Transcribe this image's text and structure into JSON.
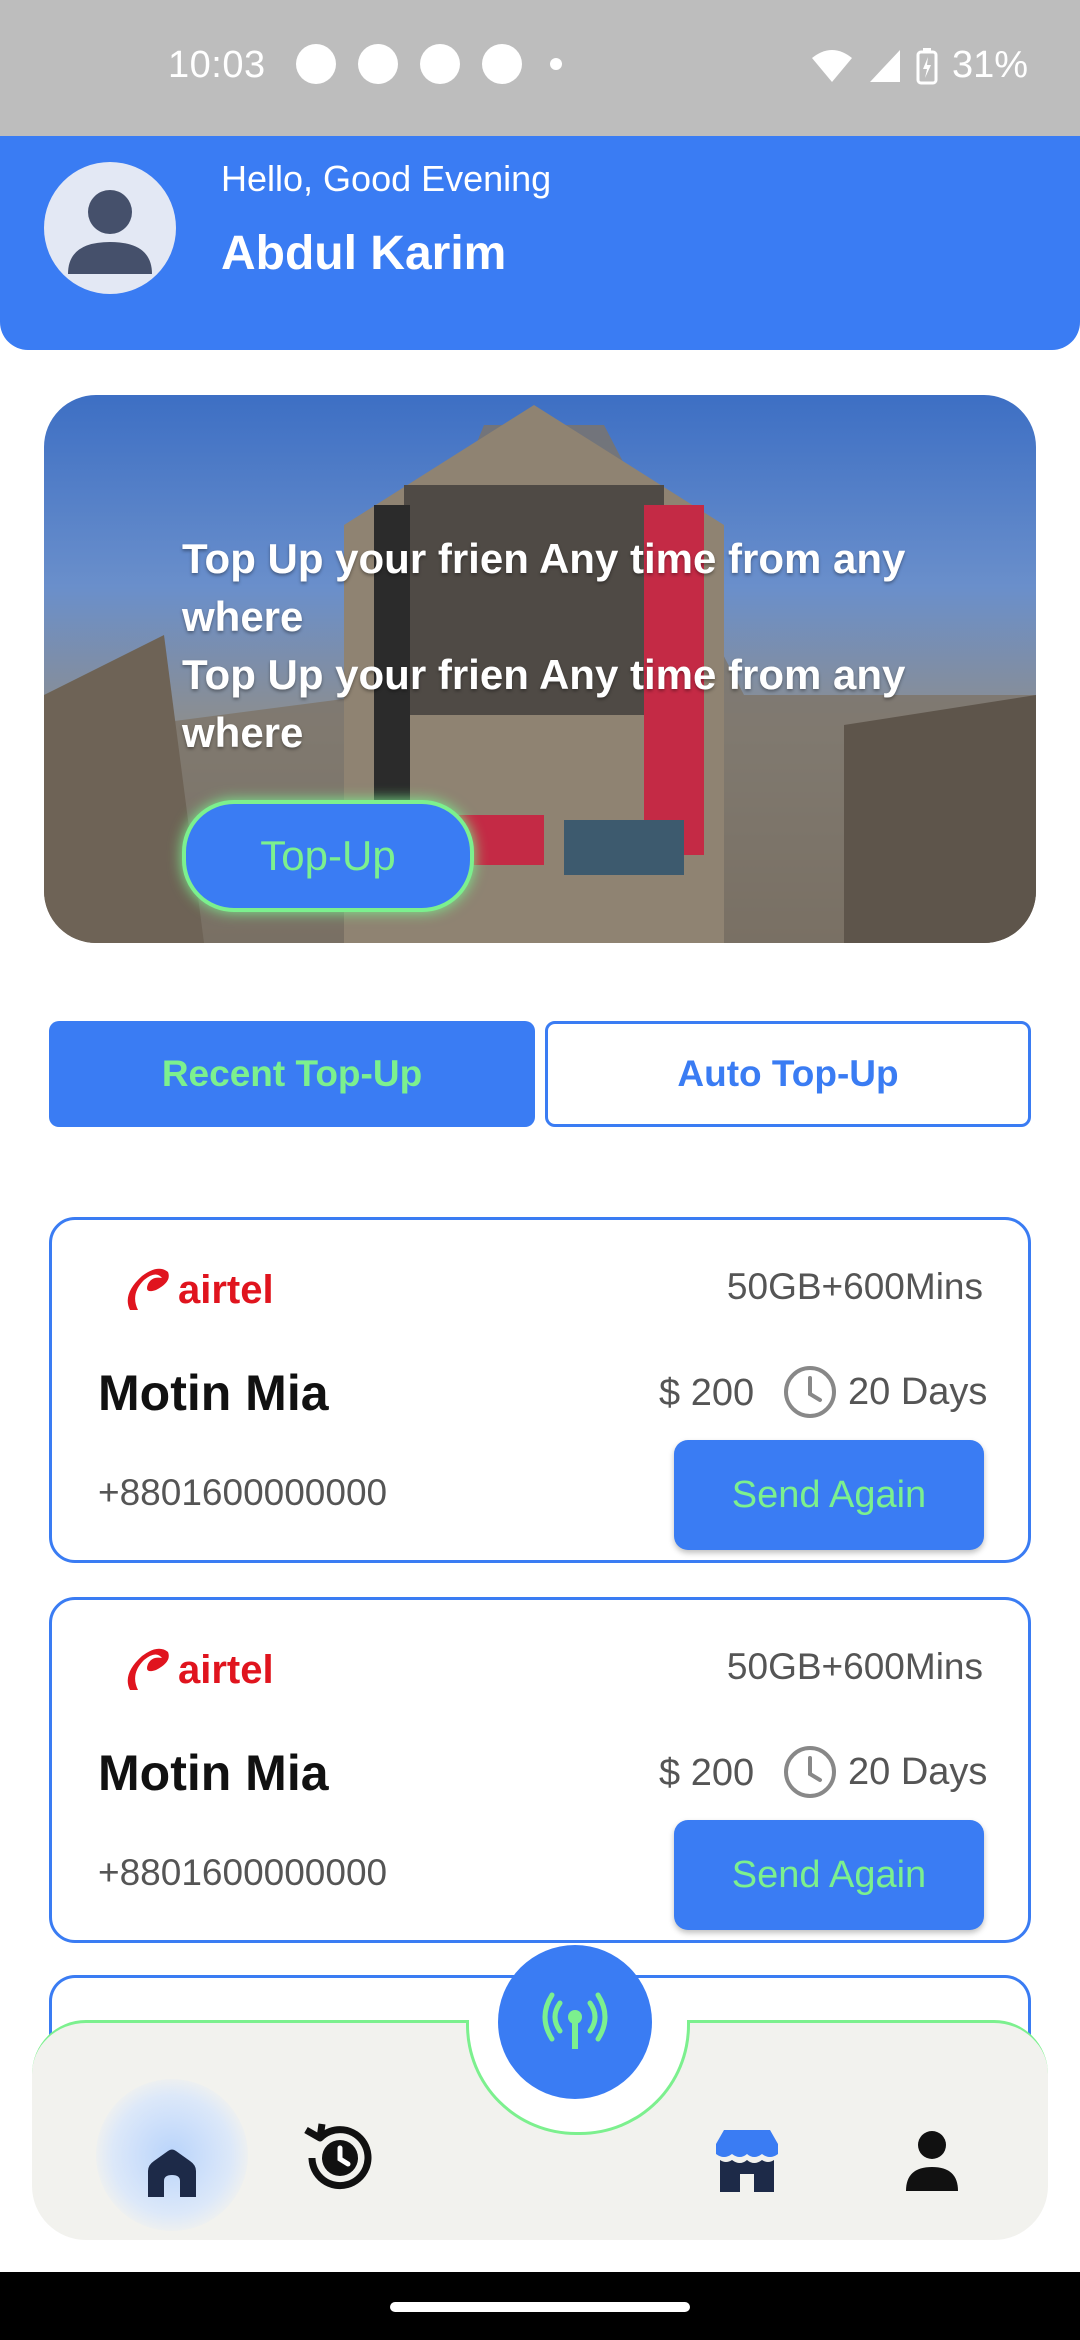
{
  "status_bar": {
    "time": "10:03",
    "battery": "31%",
    "app_icons": [
      "whatsapp-icon",
      "messenger-icon",
      "skype-icon",
      "chat-icon"
    ]
  },
  "header": {
    "greeting": "Hello, Good Evening",
    "user_name": "Abdul Karim"
  },
  "banner": {
    "line1": "Top Up your frien Any time from any where",
    "line2": "Top Up your frien Any time from any where",
    "button_label": "Top-Up"
  },
  "tabs": {
    "recent": "Recent Top-Up",
    "auto": "Auto Top-Up"
  },
  "cards": [
    {
      "operator": "airtel",
      "plan": "50GB+600Mins",
      "name": "Motin Mia",
      "price": "$ 200",
      "validity": "20 Days",
      "phone": "+8801600000000",
      "button_label": "Send Again"
    },
    {
      "operator": "airtel",
      "plan": "50GB+600Mins",
      "name": "Motin Mia",
      "price": "$ 200",
      "validity": "20 Days",
      "phone": "+8801600000000",
      "button_label": "Send Again"
    }
  ],
  "nav": {
    "items": [
      "home-icon",
      "history-icon",
      "topup-signal-icon",
      "store-icon",
      "profile-icon"
    ],
    "active": "home-icon"
  },
  "colors": {
    "primary": "#3a7cf3",
    "accent": "#7cf08e",
    "airtel_red": "#e0141e"
  }
}
